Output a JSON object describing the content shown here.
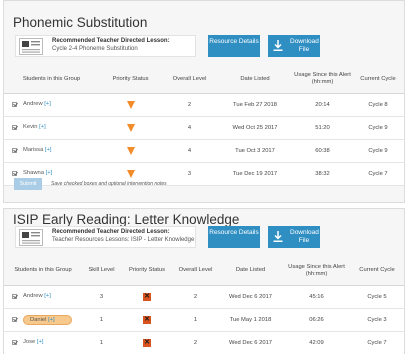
{
  "colors": {
    "button": "#2f8ec2",
    "button_disabled": "#a9cde6",
    "priority_triangle": "#f28c28",
    "priority_x": "#d9531e",
    "highlight_pill": "#f8c98c"
  },
  "sections": [
    {
      "title": "Phonemic Substitution",
      "lesson": {
        "heading": "Recommended Teacher Directed Lesson:",
        "subtitle": "Cycle 2-4 Phoneme Substitution",
        "icon": "lesson-document-icon"
      },
      "resource_label": "Resource Details",
      "download_label": "Download File",
      "columns": [
        "Students in this Group",
        "Priority Status",
        "Overall Level",
        "Date Listed",
        "Usage Since this Alert (hh:mm)",
        "Current Cycle"
      ],
      "rows": [
        {
          "name": "Andrew",
          "plus": "[+]",
          "priority": "warning-triangle-icon",
          "level": "2",
          "date": "Tue Feb 27 2018",
          "usage": "20:14",
          "cycle": "Cycle 8"
        },
        {
          "name": "Kevin",
          "plus": "[+]",
          "priority": "warning-triangle-icon",
          "level": "4",
          "date": "Wed Oct 25 2017",
          "usage": "51:20",
          "cycle": "Cycle 9"
        },
        {
          "name": "Marissa",
          "plus": "[+]",
          "priority": "warning-triangle-icon",
          "level": "4",
          "date": "Tue Oct 3 2017",
          "usage": "60:38",
          "cycle": "Cycle 9"
        },
        {
          "name": "Shawna",
          "plus": "[+]",
          "priority": "warning-triangle-icon",
          "level": "3",
          "date": "Tue Dec 19 2017",
          "usage": "38:32",
          "cycle": "Cycle 7"
        }
      ],
      "submit_label": "Submit",
      "submit_note": "Save checked boxes and optional intervention notes"
    },
    {
      "title": "ISIP Early Reading: Letter Knowledge",
      "lesson": {
        "heading": "Recommended Teacher Directed Lesson:",
        "subtitle": "Teacher Resources Lessons: ISIP - Letter Knowledge",
        "icon": "lesson-document-icon"
      },
      "resource_label": "Resource Details",
      "download_label": "Download File",
      "columns": [
        "Students in this Group",
        "Skill Level",
        "Priority Status",
        "Overall Level",
        "Date Listed",
        "Usage Since this Alert (hh:mm)",
        "Current Cycle"
      ],
      "rows": [
        {
          "name": "Andrew",
          "plus": "[+]",
          "skill": "3",
          "priority": "critical-x-icon",
          "level": "2",
          "date": "Wed Dec 6 2017",
          "usage": "45:16",
          "cycle": "Cycle 5"
        },
        {
          "name": "Daniel",
          "plus": "[+]",
          "skill": "1",
          "priority": "critical-x-icon",
          "level": "1",
          "date": "Tue May 1 2018",
          "usage": "06:26",
          "cycle": "Cycle 3"
        },
        {
          "name": "Jose",
          "plus": "[+]",
          "skill": "1",
          "priority": "critical-x-icon",
          "level": "2",
          "date": "Wed Dec 6 2017",
          "usage": "42:09",
          "cycle": "Cycle 7"
        }
      ]
    }
  ]
}
